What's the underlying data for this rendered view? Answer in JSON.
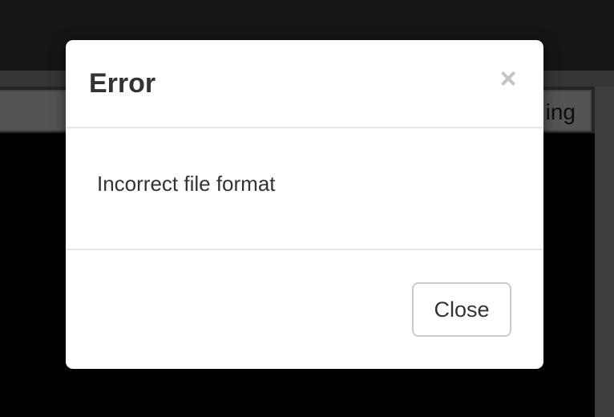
{
  "background_app": {
    "tab_label": "ing"
  },
  "dialog": {
    "title": "Error",
    "close_icon": "×",
    "message": "Incorrect file format",
    "close_button_label": "Close"
  },
  "colors": {
    "overlay": "rgba(0,0,0,0.5)",
    "dialog_background": "#ffffff",
    "text": "#333333",
    "divider": "#e5e5e5",
    "close_icon": "#c4c4c4"
  }
}
